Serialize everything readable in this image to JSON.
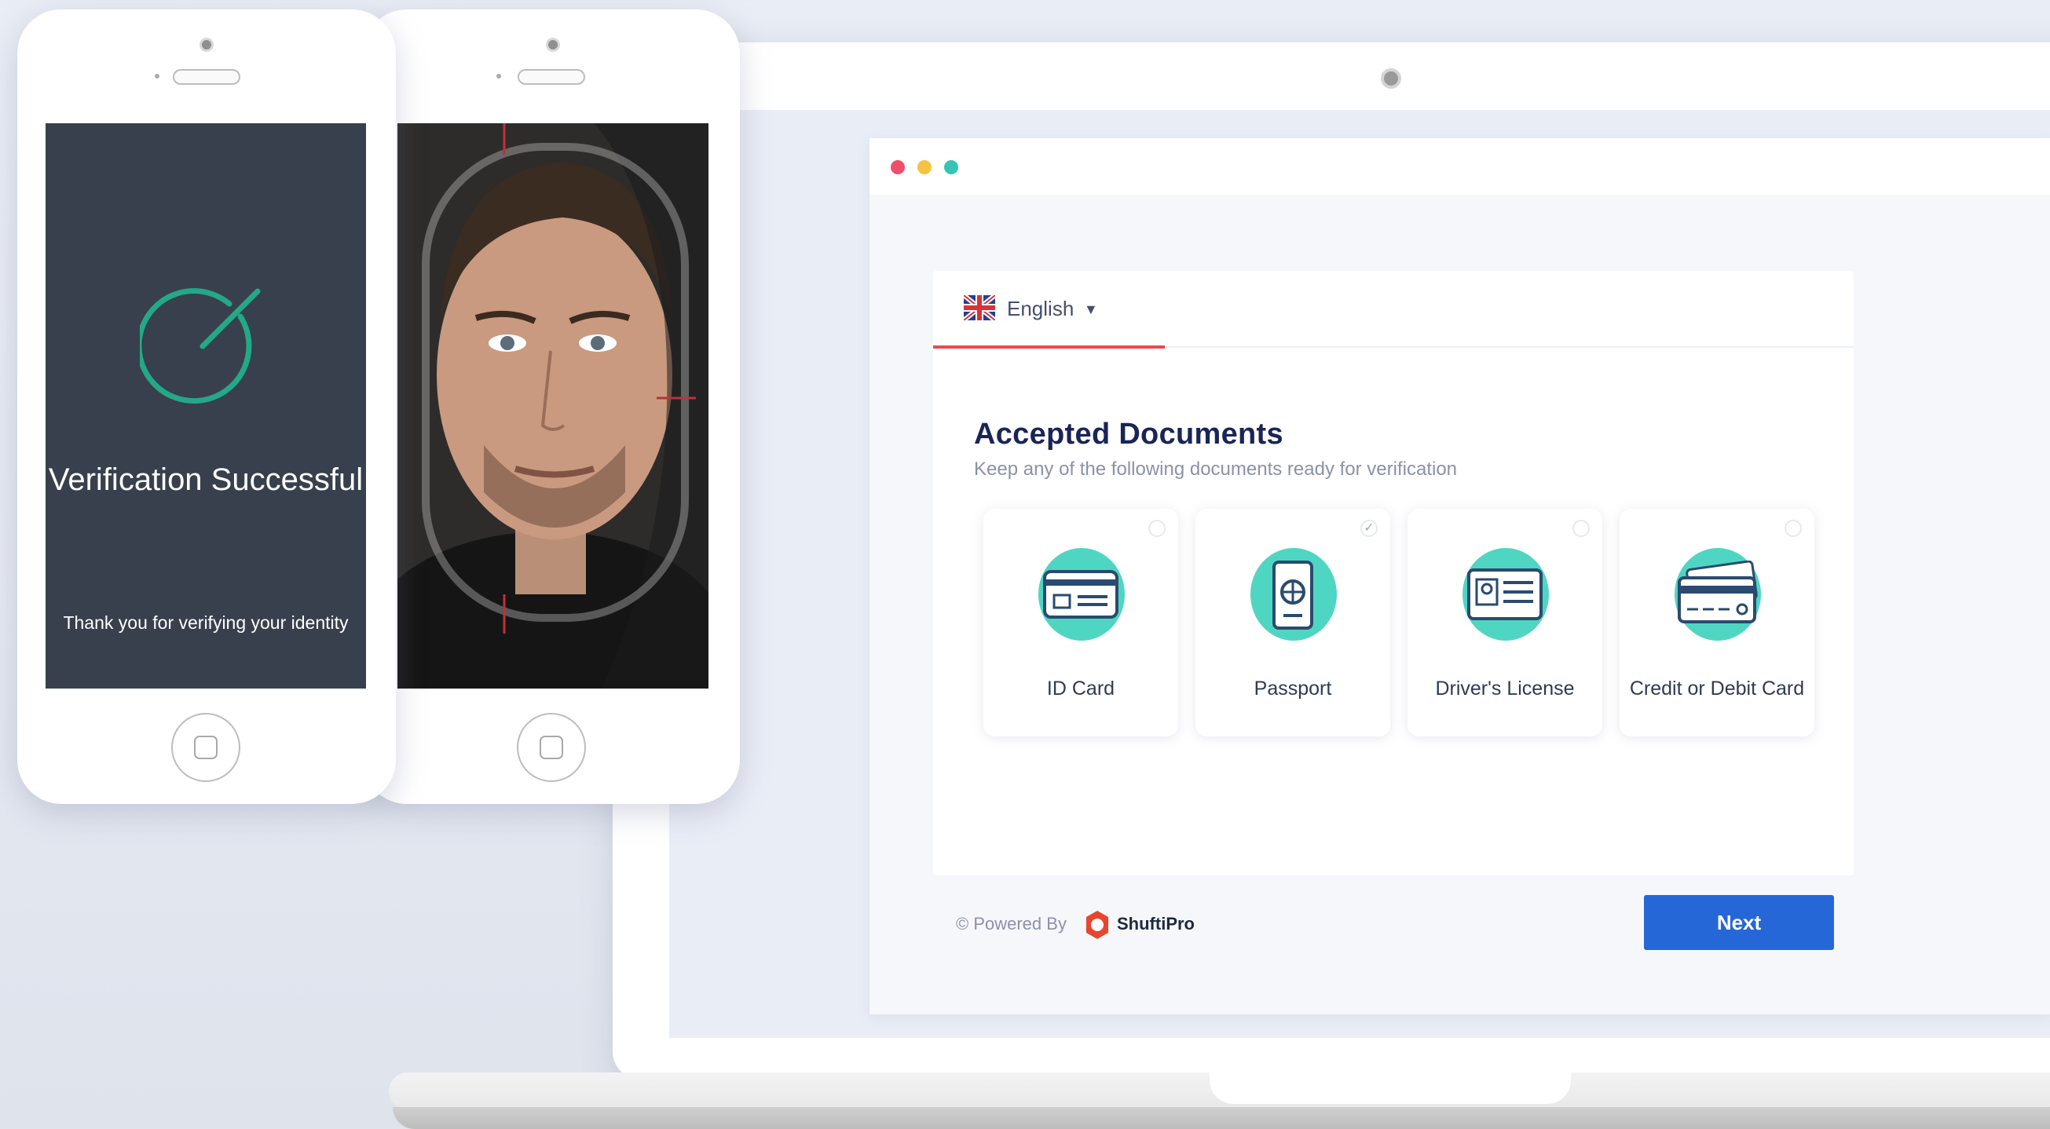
{
  "language": {
    "label": "English"
  },
  "documents": {
    "title": "Accepted Documents",
    "subtitle": "Keep any of the following documents ready for verification",
    "items": [
      {
        "label": "ID Card",
        "icon": "id-card-icon",
        "selected": false
      },
      {
        "label": "Passport",
        "icon": "passport-icon",
        "selected": true
      },
      {
        "label": "Driver's License",
        "icon": "drivers-license-icon",
        "selected": false
      },
      {
        "label": "Credit or Debit Card",
        "icon": "credit-card-icon",
        "selected": false
      }
    ]
  },
  "footer": {
    "powered_by": "© Powered By",
    "brand": "ShuftiPro",
    "next_label": "Next"
  },
  "phone_success": {
    "title": "Verification Successful",
    "message": "Thank you for verifying your identity"
  },
  "colors": {
    "accent_blue": "#2667d8",
    "teal": "#4fd6c2",
    "tab_underline": "#e94b4b",
    "success_green": "#23a987",
    "phone_screen_dark": "#38404d"
  }
}
